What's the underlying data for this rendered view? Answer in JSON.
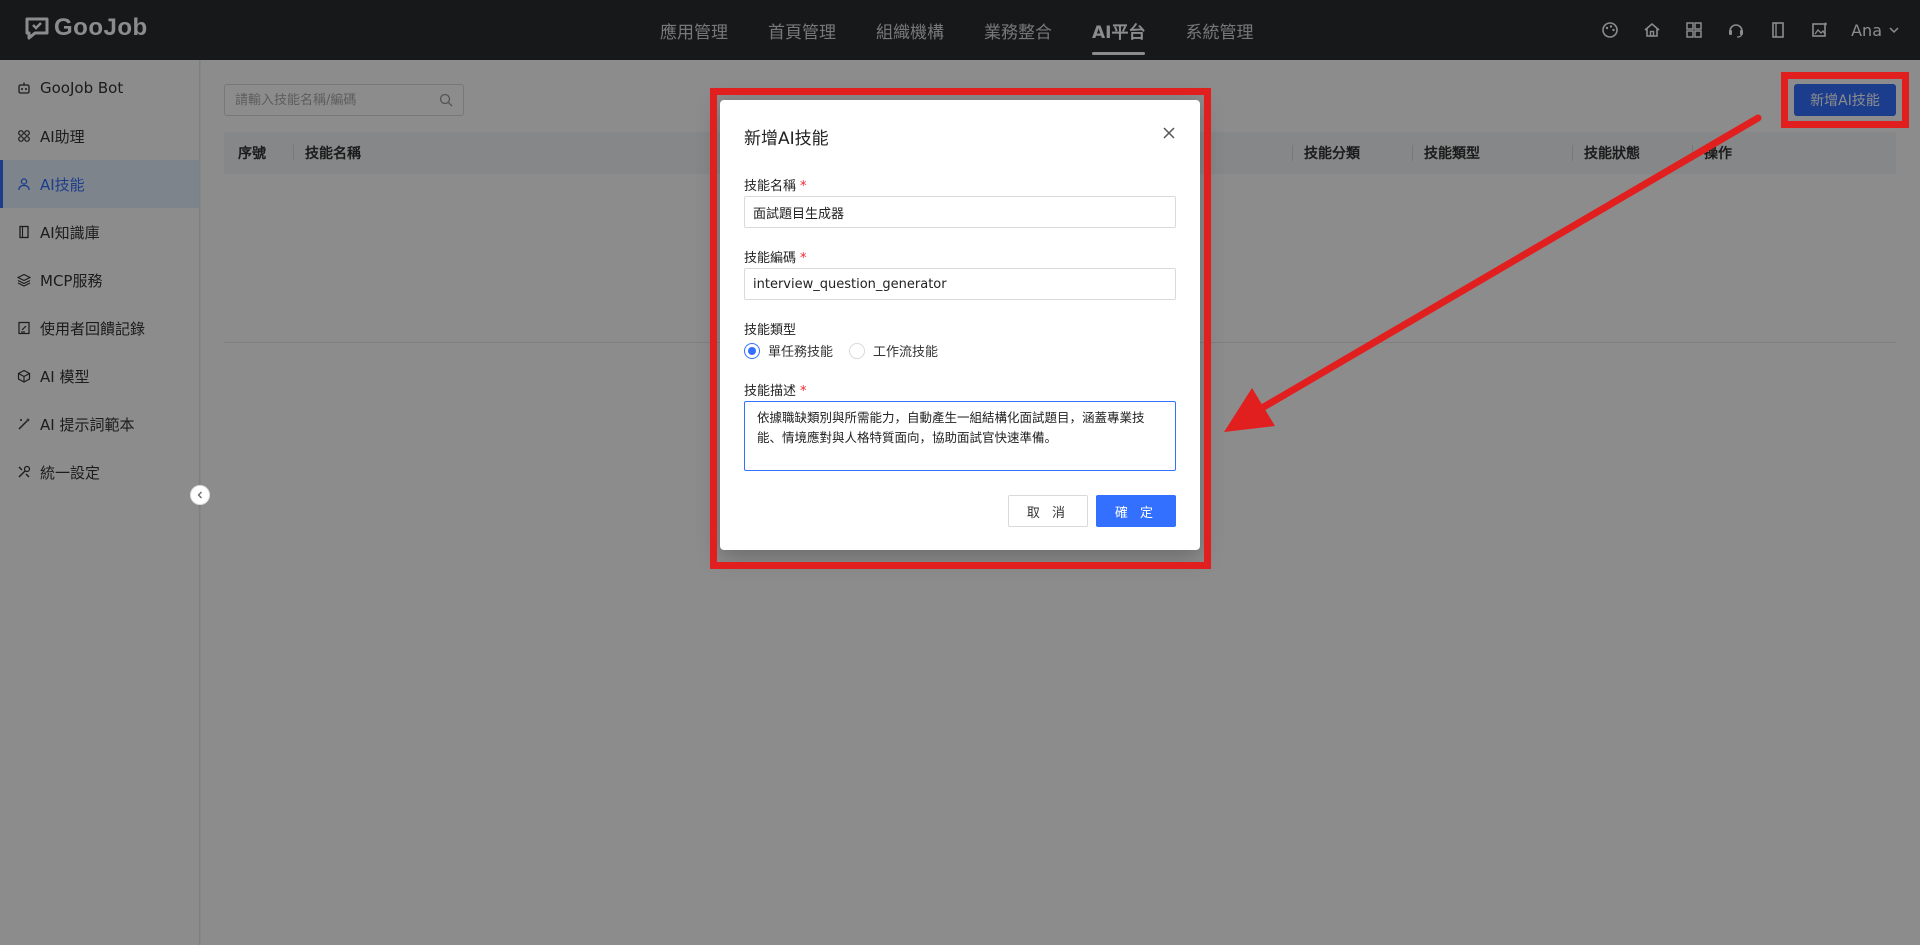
{
  "brand": {
    "name": "GooJob"
  },
  "nav": {
    "items": [
      {
        "label": "應用管理",
        "active": false
      },
      {
        "label": "首頁管理",
        "active": false
      },
      {
        "label": "組織機構",
        "active": false
      },
      {
        "label": "業務整合",
        "active": false
      },
      {
        "label": "AI平台",
        "active": true
      },
      {
        "label": "系統管理",
        "active": false
      }
    ]
  },
  "header_icons": [
    "palette-icon",
    "home-icon",
    "apps-grid-icon",
    "support-icon",
    "book-icon",
    "image-edit-icon"
  ],
  "user": {
    "name": "Ana"
  },
  "sidebar": {
    "items": [
      {
        "label": "GooJob Bot",
        "icon": "bot-icon"
      },
      {
        "label": "AI助理",
        "icon": "grid-icon"
      },
      {
        "label": "AI技能",
        "icon": "user-skill-icon",
        "active": true
      },
      {
        "label": "AI知識庫",
        "icon": "book-icon"
      },
      {
        "label": "MCP服務",
        "icon": "layers-icon"
      },
      {
        "label": "使用者回饋記錄",
        "icon": "feedback-icon"
      },
      {
        "label": "AI 模型",
        "icon": "cube-icon"
      },
      {
        "label": "AI 提示詞範本",
        "icon": "wand-icon"
      },
      {
        "label": "統一設定",
        "icon": "settings-icon"
      }
    ]
  },
  "main": {
    "search_placeholder": "請輸入技能名稱/編碼",
    "add_button": "新增AI技能",
    "table_headers": {
      "index": "序號",
      "name": "技能名稱",
      "category": "技能分類",
      "type": "技能類型",
      "status": "技能狀態",
      "actions": "操作"
    }
  },
  "modal": {
    "title": "新增AI技能",
    "name_label": "技能名稱",
    "name_value": "面試題目生成器",
    "code_label": "技能編碼",
    "code_value": "interview_question_generator",
    "type_label": "技能類型",
    "type_options": [
      {
        "label": "單任務技能",
        "checked": true
      },
      {
        "label": "工作流技能",
        "checked": false
      }
    ],
    "desc_label": "技能描述",
    "desc_value": "依據職缺類別與所需能力，自動產生一組結構化面試題目，涵蓋專業技能、情境應對與人格特質面向，協助面試官快速準備。",
    "cancel": "取 消",
    "ok": "確 定"
  },
  "colors": {
    "accent": "#3370ff",
    "topbar": "#2b2d31",
    "annotation": "#e21f1f"
  }
}
